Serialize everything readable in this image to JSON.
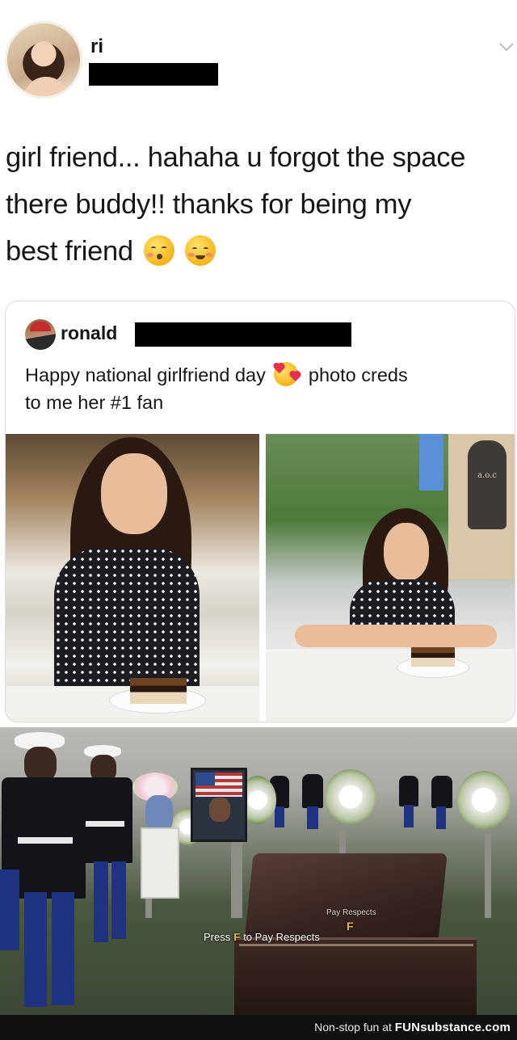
{
  "tweet": {
    "author_name": "ri",
    "text_lines": [
      "girl friend... hahaha u forgot the space",
      "there buddy!! thanks for being my",
      "best friend"
    ],
    "emojis": [
      "kissing-face-emoji",
      "relieved-face-emoji"
    ]
  },
  "quoted_tweet": {
    "author_name": "ronald",
    "text_before_emoji": "Happy national girlfriend day",
    "emoji": "smiling-face-with-hearts-emoji",
    "text_after_emoji": "photo creds",
    "text_line2": "to me her #1 fan",
    "photo_sign_text": "a.o.c"
  },
  "game": {
    "prompt_prefix": "Press",
    "prompt_key": "F",
    "prompt_suffix": "to Pay Respects",
    "overlay_label": "Pay Respects",
    "overlay_key": "F"
  },
  "footer": {
    "tagline": "Non-stop fun at",
    "brand": "FUNsubstance.com"
  },
  "colors": {
    "text": "#14171a",
    "card_border": "#d7dde2",
    "redaction": "#000000",
    "game_key": "#e8b44a",
    "footer_bg": "#0f0f10"
  }
}
